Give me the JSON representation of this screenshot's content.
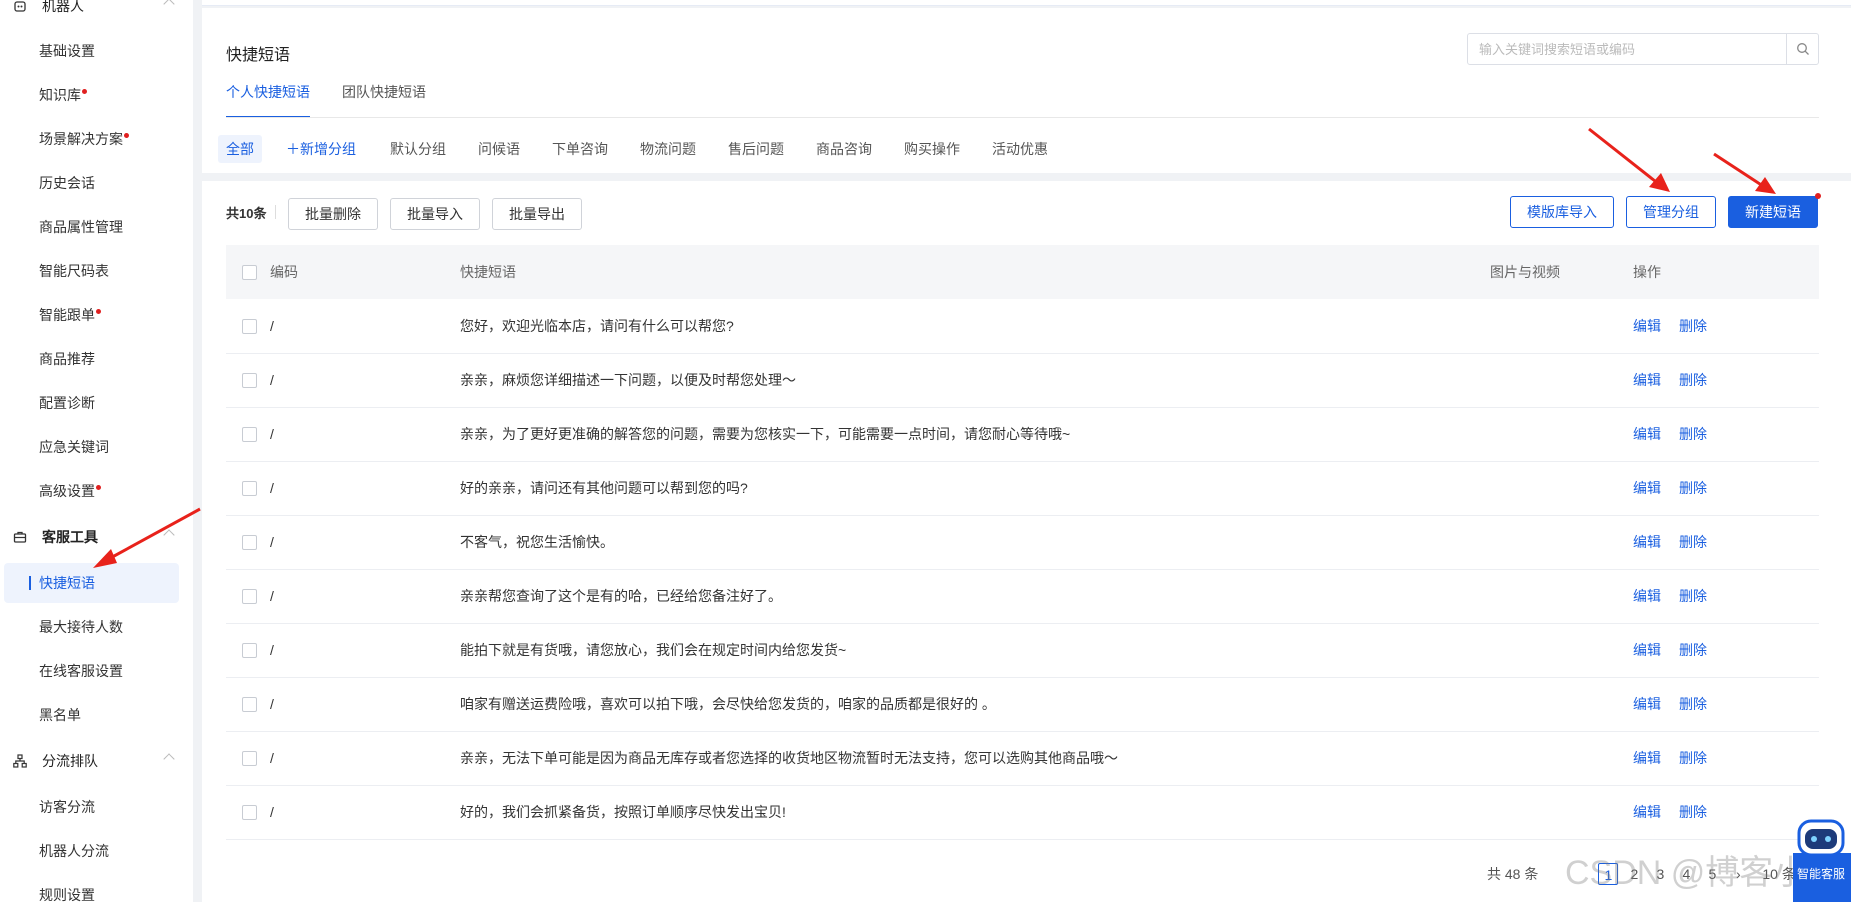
{
  "sidebar": {
    "group_robot": "机器人",
    "robot_items": [
      {
        "label": "基础设置",
        "dot": false
      },
      {
        "label": "知识库",
        "dot": true
      },
      {
        "label": "场景解决方案",
        "dot": true
      },
      {
        "label": "历史会话",
        "dot": false
      },
      {
        "label": "商品属性管理",
        "dot": false
      },
      {
        "label": "智能尺码表",
        "dot": false
      },
      {
        "label": "智能跟单",
        "dot": true
      },
      {
        "label": "商品推荐",
        "dot": false
      },
      {
        "label": "配置诊断",
        "dot": false
      },
      {
        "label": "应急关键词",
        "dot": false
      },
      {
        "label": "高级设置",
        "dot": true
      }
    ],
    "group_tools": "客服工具",
    "tool_items": [
      {
        "label": "快捷短语",
        "active": true
      },
      {
        "label": "最大接待人数"
      },
      {
        "label": "在线客服设置"
      },
      {
        "label": "黑名单"
      }
    ],
    "group_queue": "分流排队",
    "queue_items": [
      {
        "label": "访客分流"
      },
      {
        "label": "机器人分流"
      },
      {
        "label": "规则设置"
      }
    ]
  },
  "header": {
    "title": "快捷短语",
    "search_placeholder": "输入关键词搜索短语或编码",
    "tabs": [
      "个人快捷短语",
      "团队快捷短语"
    ],
    "active_tab": 0
  },
  "categories": {
    "all": "全部",
    "add": "＋新增分组",
    "items": [
      "默认分组",
      "问候语",
      "下单咨询",
      "物流问题",
      "售后问题",
      "商品咨询",
      "购买操作",
      "活动优惠"
    ]
  },
  "toolbar": {
    "count": "共10条",
    "batch_delete": "批量删除",
    "batch_import": "批量导入",
    "batch_export": "批量导出",
    "template_import": "模版库导入",
    "manage_groups": "管理分组",
    "new_phrase": "新建短语"
  },
  "table": {
    "headers": {
      "code": "编码",
      "phrase": "快捷短语",
      "media": "图片与视频",
      "ops": "操作"
    },
    "edit": "编辑",
    "delete": "删除",
    "rows": [
      {
        "code": "/",
        "phrase": "您好，欢迎光临本店，请问有什么可以帮您?"
      },
      {
        "code": "/",
        "phrase": "亲亲，麻烦您详细描述一下问题，以便及时帮您处理～"
      },
      {
        "code": "/",
        "phrase": "亲亲，为了更好更准确的解答您的问题，需要为您核实一下，可能需要一点时间，请您耐心等待哦~"
      },
      {
        "code": "/",
        "phrase": "好的亲亲，请问还有其他问题可以帮到您的吗?"
      },
      {
        "code": "/",
        "phrase": "不客气，祝您生活愉快。"
      },
      {
        "code": "/",
        "phrase": "亲亲帮您查询了这个是有的哈，已经给您备注好了。"
      },
      {
        "code": "/",
        "phrase": "能拍下就是有货哦，请您放心，我们会在规定时间内给您发货~"
      },
      {
        "code": "/",
        "phrase": "咱家有赠送运费险哦，喜欢可以拍下哦，会尽快给您发货的，咱家的品质都是很好的 。"
      },
      {
        "code": "/",
        "phrase": "亲亲，无法下单可能是因为商品无库存或者您选择的收货地区物流暂时无法支持，您可以选购其他商品哦～"
      },
      {
        "code": "/",
        "phrase": "好的，我们会抓紧备货，按照订单顺序尽快发出宝贝!"
      }
    ]
  },
  "pager": {
    "total": "共 48 条",
    "pages": [
      "1",
      "2",
      "3",
      "4",
      "5"
    ],
    "active": "1",
    "next": "›",
    "page_size": "10 条/页"
  },
  "watermark": "CSDN @博客小宏",
  "robot_label": "智能客服",
  "colors": {
    "accent": "#1a5fe0",
    "arrow": "#e8221b",
    "dot": "#e02020"
  }
}
